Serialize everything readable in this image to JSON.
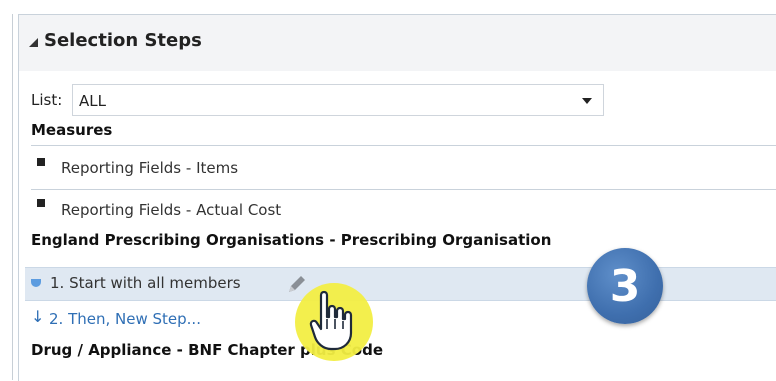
{
  "panel": {
    "title": "Selection Steps",
    "list": {
      "label": "List:",
      "value": "ALL"
    }
  },
  "measures": {
    "heading": "Measures",
    "items": [
      {
        "label": "Reporting Fields - Items"
      },
      {
        "label": "Reporting Fields - Actual Cost"
      }
    ]
  },
  "org_section": {
    "heading": "England Prescribing Organisations - Prescribing Organisation",
    "steps": [
      {
        "label": "1. Start with all members"
      }
    ],
    "new_step": {
      "label": "2. Then, New Step..."
    }
  },
  "drug_section": {
    "heading": "Drug / Appliance - BNF Chapter plus Code"
  },
  "callout": {
    "number": "3"
  },
  "colors": {
    "header_bg": "#f3f4f6",
    "selected_row_bg": "#dfe8f2",
    "link_blue": "#2f6fb5",
    "badge_blue": "#3f6fae",
    "cursor_highlight": "#f2ee43"
  },
  "icons": [
    "collapse-triangle-icon",
    "blue-step-dot-icon",
    "pencil-edit-icon",
    "down-arrow-icon",
    "hand-pointer-icon"
  ]
}
